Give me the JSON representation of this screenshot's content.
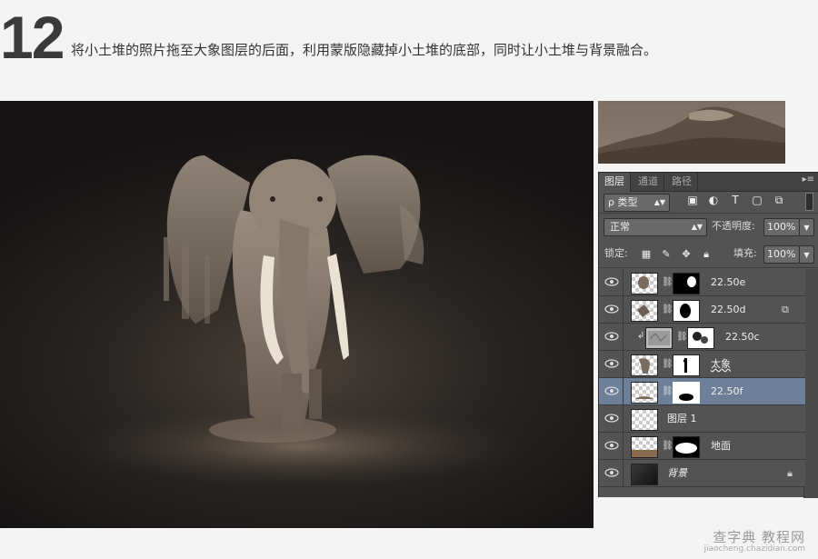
{
  "header": {
    "step_number": "12",
    "instruction": "将小土堆的照片拖至大象图层的后面，利用蒙版隐藏掉小土堆的底部，同时让小土堆与背景融合。"
  },
  "panel": {
    "tabs": [
      "图层",
      "通道",
      "路径"
    ],
    "active_tab": "图层",
    "filter": {
      "label": "ρ 类型"
    },
    "blend_mode": "正常",
    "opacity_label": "不透明度:",
    "opacity_value": "100%",
    "lock_label": "锁定:",
    "fill_label": "填充:",
    "fill_value": "100%",
    "layers": [
      {
        "name": "22.50e"
      },
      {
        "name": "22.50d"
      },
      {
        "name": "22.50c"
      },
      {
        "name": "太象"
      },
      {
        "name": "22.50f"
      },
      {
        "name": "图层 1"
      },
      {
        "name": "地面"
      },
      {
        "name": "背景"
      }
    ],
    "selected_layer": "22.50f"
  },
  "watermark": {
    "main": "查字典 教程网",
    "sub": "jiaocheng.chazidian.com"
  }
}
